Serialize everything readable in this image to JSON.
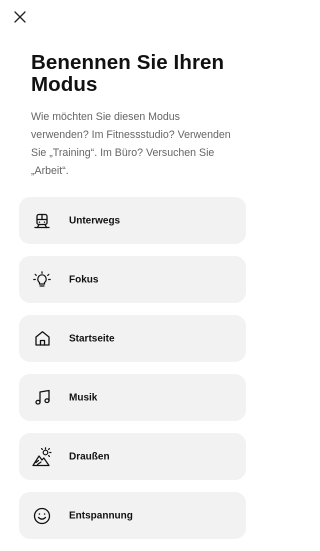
{
  "header": {
    "close_icon": "close-icon",
    "title": "Benennen Sie Ihren Modus",
    "description": "Wie möchten Sie diesen Modus verwenden? Im Fitnessstudio? Verwenden Sie „Training“. Im Büro? Versuchen Sie „Arbeit“."
  },
  "modes": [
    {
      "label": "Unterwegs",
      "icon": "train-icon"
    },
    {
      "label": "Fokus",
      "icon": "lightbulb-icon"
    },
    {
      "label": "Startseite",
      "icon": "home-icon"
    },
    {
      "label": "Musik",
      "icon": "music-note-icon"
    },
    {
      "label": "Draußen",
      "icon": "mountain-sun-icon"
    },
    {
      "label": "Entspannung",
      "icon": "smiley-icon"
    }
  ],
  "colors": {
    "background": "#ffffff",
    "tile": "#f2f2f2",
    "text": "#111111",
    "muted_text": "#666666"
  }
}
